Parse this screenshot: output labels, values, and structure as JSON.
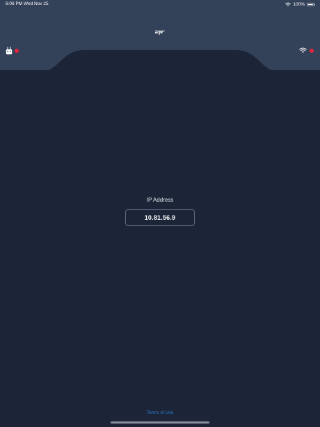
{
  "status_bar": {
    "time": "6:06 PM",
    "date": "Wed Nov 25",
    "battery": "100%",
    "battery_level": 1.0
  },
  "header": {
    "logo_icon": "dji-logo-icon",
    "left_device_icon": "remote-controller-icon",
    "left_status_color": "#e8233b",
    "right_device_icon": "wifi-icon",
    "right_status_color": "#e8233b"
  },
  "main": {
    "ip_label": "IP Address",
    "ip_value": "10.81.56.9"
  },
  "footer": {
    "terms_link": "Terms of Use"
  },
  "colors": {
    "background": "#1b2537",
    "header": "#334159",
    "accent_link": "#2f7fd1",
    "status_dot": "#e8233b"
  }
}
